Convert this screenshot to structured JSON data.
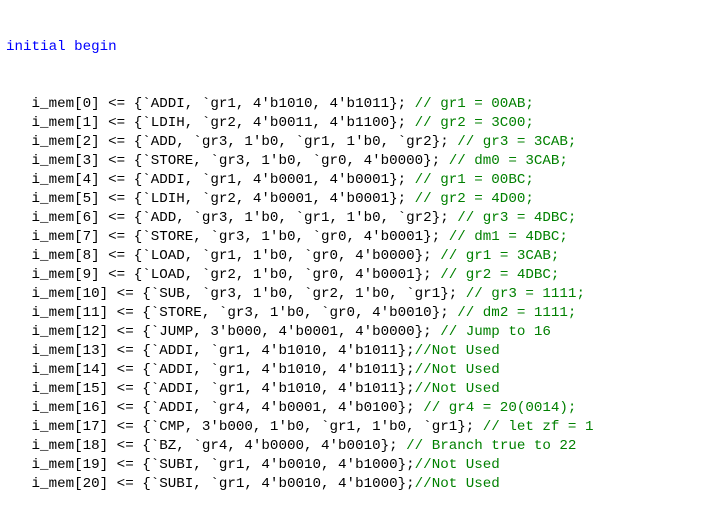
{
  "editor": {
    "header": {
      "keyword": "initial begin"
    },
    "indent": "   ",
    "lines": [
      {
        "code": "i_mem[0] <= {`ADDI, `gr1, 4'b1010, 4'b1011}; ",
        "comment": "// gr1 = 00AB;"
      },
      {
        "code": "i_mem[1] <= {`LDIH, `gr2, 4'b0011, 4'b1100}; ",
        "comment": "// gr2 = 3C00;"
      },
      {
        "code": "i_mem[2] <= {`ADD, `gr3, 1'b0, `gr1, 1'b0, `gr2}; ",
        "comment": "// gr3 = 3CAB;"
      },
      {
        "code": "i_mem[3] <= {`STORE, `gr3, 1'b0, `gr0, 4'b0000}; ",
        "comment": "// dm0 = 3CAB;"
      },
      {
        "code": "i_mem[4] <= {`ADDI, `gr1, 4'b0001, 4'b0001}; ",
        "comment": "// gr1 = 00BC;"
      },
      {
        "code": "i_mem[5] <= {`LDIH, `gr2, 4'b0001, 4'b0001}; ",
        "comment": "// gr2 = 4D00;"
      },
      {
        "code": "i_mem[6] <= {`ADD, `gr3, 1'b0, `gr1, 1'b0, `gr2}; ",
        "comment": "// gr3 = 4DBC;"
      },
      {
        "code": "i_mem[7] <= {`STORE, `gr3, 1'b0, `gr0, 4'b0001}; ",
        "comment": "// dm1 = 4DBC;"
      },
      {
        "code": "i_mem[8] <= {`LOAD, `gr1, 1'b0, `gr0, 4'b0000}; ",
        "comment": "// gr1 = 3CAB;"
      },
      {
        "code": "i_mem[9] <= {`LOAD, `gr2, 1'b0, `gr0, 4'b0001}; ",
        "comment": "// gr2 = 4DBC;"
      },
      {
        "code": "i_mem[10] <= {`SUB, `gr3, 1'b0, `gr2, 1'b0, `gr1}; ",
        "comment": "// gr3 = 1111;"
      },
      {
        "code": "i_mem[11] <= {`STORE, `gr3, 1'b0, `gr0, 4'b0010}; ",
        "comment": "// dm2 = 1111;"
      },
      {
        "code": "i_mem[12] <= {`JUMP, 3'b000, 4'b0001, 4'b0000}; ",
        "comment": "// Jump to 16"
      },
      {
        "code": "i_mem[13] <= {`ADDI, `gr1, 4'b1010, 4'b1011};",
        "comment": "//Not Used"
      },
      {
        "code": "i_mem[14] <= {`ADDI, `gr1, 4'b1010, 4'b1011};",
        "comment": "//Not Used"
      },
      {
        "code": "i_mem[15] <= {`ADDI, `gr1, 4'b1010, 4'b1011};",
        "comment": "//Not Used"
      },
      {
        "code": "i_mem[16] <= {`ADDI, `gr4, 4'b0001, 4'b0100}; ",
        "comment": "// gr4 = 20(0014);"
      },
      {
        "code": "i_mem[17] <= {`CMP, 3'b000, 1'b0, `gr1, 1'b0, `gr1}; ",
        "comment": "// let zf = 1"
      },
      {
        "code": "i_mem[18] <= {`BZ, `gr4, 4'b0000, 4'b0010}; ",
        "comment": "// Branch true to 22"
      },
      {
        "code": "i_mem[19] <= {`SUBI, `gr1, 4'b0010, 4'b1000};",
        "comment": "//Not Used"
      },
      {
        "code": "i_mem[20] <= {`SUBI, `gr1, 4'b0010, 4'b1000};",
        "comment": "//Not Used"
      }
    ]
  },
  "colors": {
    "keyword": "#0000ff",
    "code": "#000000",
    "comment": "#008000",
    "background": "#ffffff"
  }
}
